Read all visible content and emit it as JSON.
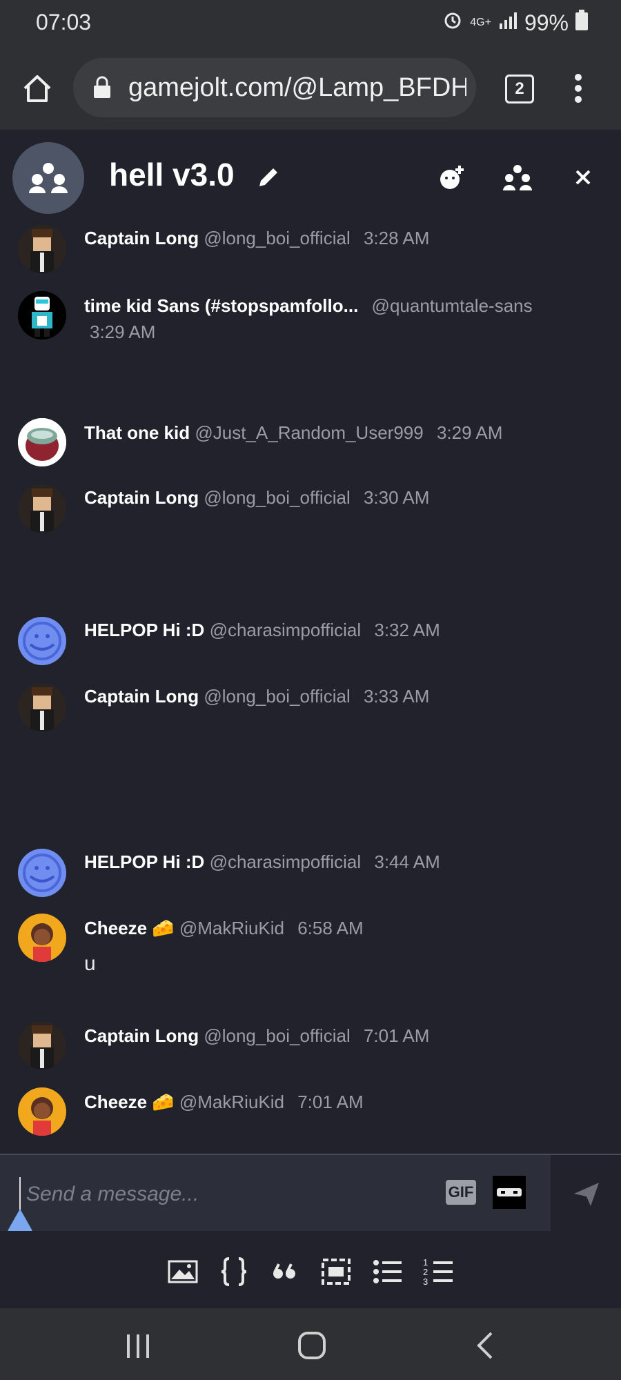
{
  "status_bar": {
    "time": "07:03",
    "network": "4G+",
    "battery": "99%"
  },
  "browser": {
    "url": "gamejolt.com/@Lamp_BFDH",
    "tab_count": "2"
  },
  "room": {
    "title": "hell v3.0"
  },
  "messages": [
    {
      "name": "Captain Long",
      "handle": "@long_boi_official",
      "time": "3:28 AM",
      "text": ""
    },
    {
      "name": "time kid Sans (#stopspamfollo...",
      "handle": "@quantumtale-sans",
      "time": "3:29 AM",
      "text": ""
    },
    {
      "name": "That one kid",
      "handle": "@Just_A_Random_User999",
      "time": "3:29 AM",
      "text": ""
    },
    {
      "name": "Captain Long",
      "handle": "@long_boi_official",
      "time": "3:30 AM",
      "text": ""
    },
    {
      "name": "HELPOP Hi :D",
      "handle": "@charasimpofficial",
      "time": "3:32 AM",
      "text": ""
    },
    {
      "name": "Captain Long",
      "handle": "@long_boi_official",
      "time": "3:33 AM",
      "text": ""
    },
    {
      "name": "HELPOP Hi :D",
      "handle": "@charasimpofficial",
      "time": "3:44 AM",
      "text": ""
    },
    {
      "name": "Cheeze 🧀",
      "handle": "@MakRiuKid",
      "time": "6:58 AM",
      "text": "u"
    },
    {
      "name": "Captain Long",
      "handle": "@long_boi_official",
      "time": "7:01 AM",
      "text": ""
    },
    {
      "name": "Cheeze 🧀",
      "handle": "@MakRiuKid",
      "time": "7:01 AM",
      "text": ""
    }
  ],
  "composer": {
    "placeholder": "Send a message...",
    "gif_label": "GIF"
  },
  "colors": {
    "background": "#22222d",
    "bar": "#2f3033",
    "accent_drop": "#7aa7f0"
  }
}
